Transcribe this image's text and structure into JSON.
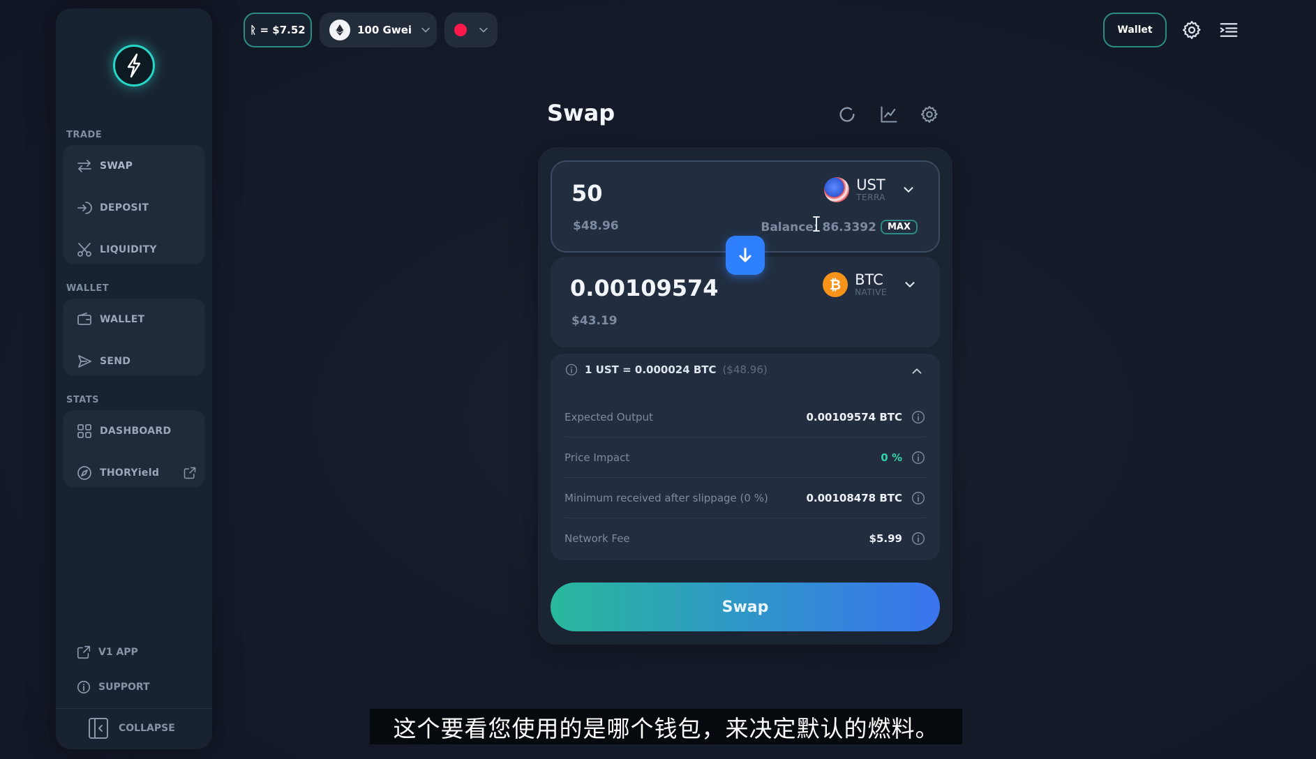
{
  "topbar": {
    "rune_price": "ᚱ = $7.52",
    "gas_label": "100 Gwei",
    "wallet_button": "Wallet",
    "status_color": "#ff1a4b"
  },
  "sidebar": {
    "sections": {
      "trade": "TRADE",
      "wallet": "WALLET",
      "stats": "STATS"
    },
    "trade_items": [
      {
        "label": "SWAP",
        "icon": "swap-arrows-icon"
      },
      {
        "label": "DEPOSIT",
        "icon": "deposit-icon"
      },
      {
        "label": "LIQUIDITY",
        "icon": "liquidity-icon"
      }
    ],
    "wallet_items": [
      {
        "label": "WALLET",
        "icon": "wallet-icon"
      },
      {
        "label": "SEND",
        "icon": "send-icon"
      }
    ],
    "stats_items": [
      {
        "label": "DASHBOARD",
        "icon": "dashboard-icon"
      },
      {
        "label": "THORYield",
        "icon": "compass-icon"
      }
    ],
    "bottom": {
      "v1_app": "V1 APP",
      "support": "SUPPORT",
      "collapse": "COLLAPSE"
    }
  },
  "swap": {
    "title": "Swap",
    "from": {
      "amount": "50",
      "usd": "$48.96",
      "symbol": "UST",
      "chain": "TERRA",
      "balance_label": "Balance: 86.3392",
      "max_label": "MAX"
    },
    "to": {
      "amount": "0.00109574",
      "usd": "$43.19",
      "symbol": "BTC",
      "chain": "NATIVE"
    },
    "rate": {
      "text": "1 UST = 0.000024 BTC",
      "usd": "($48.96)"
    },
    "details": [
      {
        "label": "Expected Output",
        "value": "0.00109574 BTC"
      },
      {
        "label": "Price Impact",
        "value": "0 %"
      },
      {
        "label": "Minimum received after slippage (0 %)",
        "value": "0.00108478 BTC"
      },
      {
        "label": "Network Fee",
        "value": "$5.99"
      }
    ],
    "button": "Swap"
  },
  "subtitle": "这个要看您使用的是哪个钱包，来决定默认的燃料。",
  "colors": {
    "accent_teal": "#2c8c85",
    "accent_blue": "#2e80ff",
    "positive_green": "#2fd4a6",
    "background": "#121826"
  }
}
